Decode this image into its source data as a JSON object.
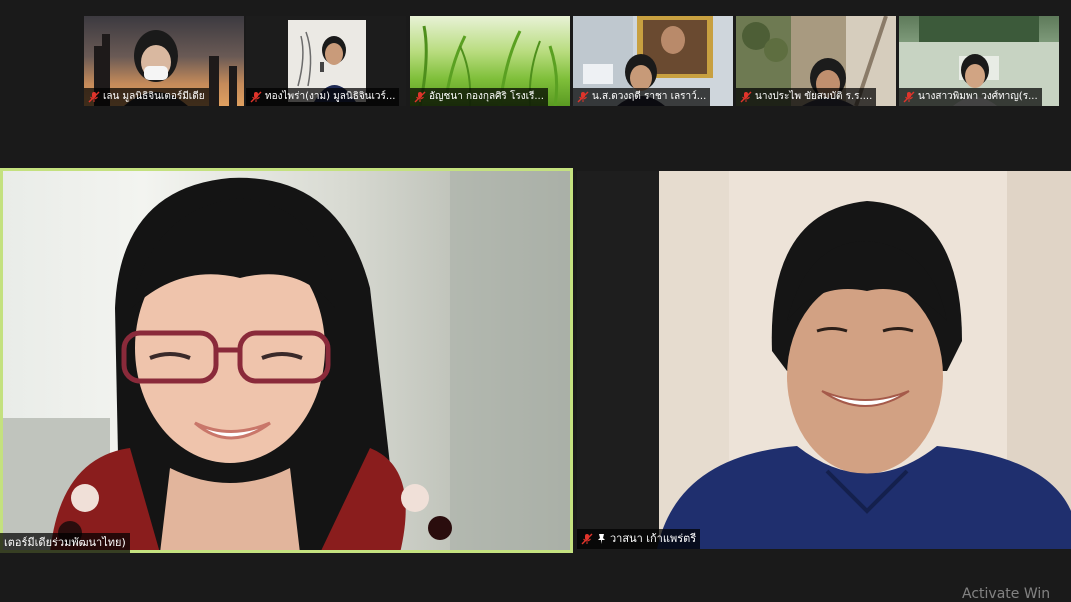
{
  "gallery": {
    "thumbnails": [
      {
        "name": "เลน มูลนิธิจินเตอร์มีเดีย",
        "muted": true
      },
      {
        "name": "ทองไพร่า(งาม) มูลนิธิจินเวร์...",
        "muted": true
      },
      {
        "name": "อัญชนา กองกุลศิริ โรงเรี...",
        "muted": true
      },
      {
        "name": "น.ส.ดวงฤดี ราชา เลราว์...",
        "muted": true
      },
      {
        "name": "นางประไพ ขัยสมบัติ ร.ร....",
        "muted": true
      },
      {
        "name": "นางสาวพิมพา วงศ์ทาญ(ร...",
        "muted": true
      }
    ]
  },
  "main": {
    "speaker": {
      "name": "เตอร์มีเดียร่วมพัฒนาไทย)",
      "active_border_color": "#c4e17f"
    },
    "pinned": {
      "name": "วาสนา เก้าแพร่ตรี",
      "muted": true,
      "pinned": true
    }
  },
  "system": {
    "watermark": "Activate Win"
  },
  "colors": {
    "muted_mic": "#e0342b",
    "active_speaker": "#c4e17f",
    "background": "#1a1a1a"
  }
}
